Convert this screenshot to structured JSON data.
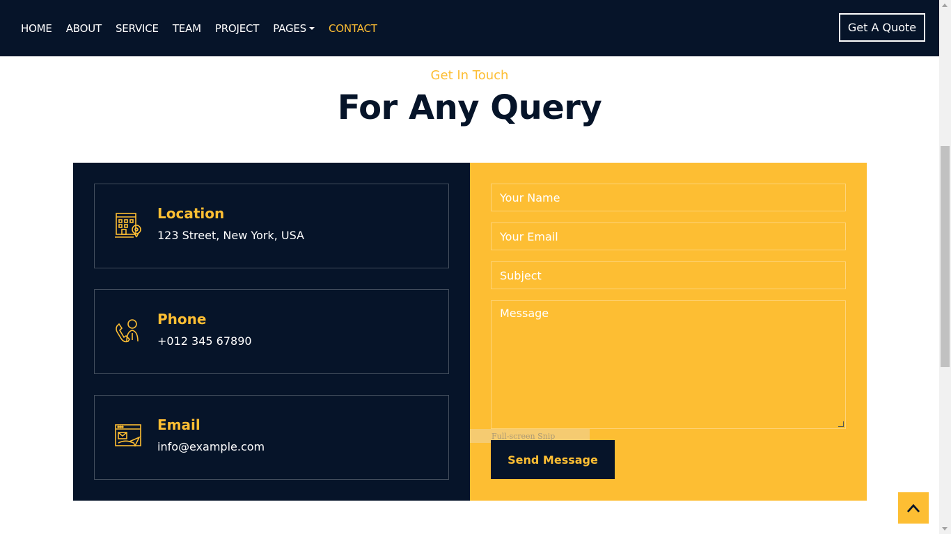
{
  "nav": {
    "items": [
      {
        "label": "HOME"
      },
      {
        "label": "ABOUT"
      },
      {
        "label": "SERVICE"
      },
      {
        "label": "TEAM"
      },
      {
        "label": "PROJECT"
      },
      {
        "label": "PAGES"
      },
      {
        "label": "CONTACT"
      }
    ],
    "quote_button": "Get A Quote",
    "active": "CONTACT"
  },
  "section": {
    "subtitle": "Get In Touch",
    "title": "For Any Query"
  },
  "info": [
    {
      "title": "Location",
      "text": "123 Street, New York, USA",
      "icon": "location-building-icon"
    },
    {
      "title": "Phone",
      "text": "+012 345 67890",
      "icon": "phone-support-icon"
    },
    {
      "title": "Email",
      "text": "info@example.com",
      "icon": "email-browser-icon"
    }
  ],
  "form": {
    "name_placeholder": "Your Name",
    "email_placeholder": "Your Email",
    "subject_placeholder": "Subject",
    "message_placeholder": "Message",
    "send_label": "Send Message",
    "snip_overlay": "Full-screen Snip"
  },
  "colors": {
    "navy": "#061429",
    "accent": "#FDBE33",
    "white": "#ffffff"
  }
}
